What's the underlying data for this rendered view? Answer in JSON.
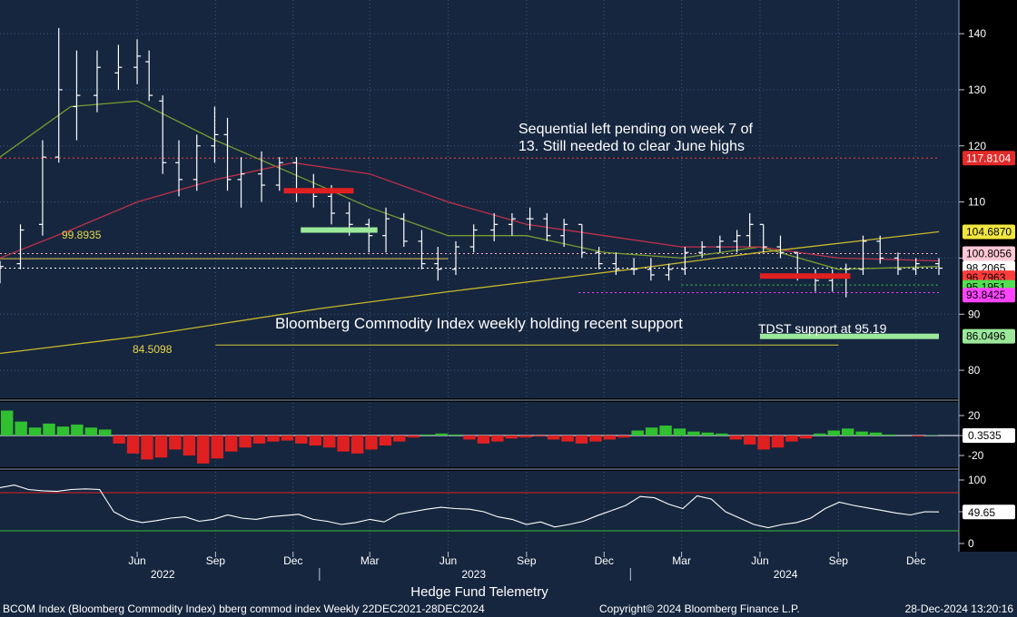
{
  "chart_data": {
    "type": "candlestick",
    "main_panel": {
      "ylim": [
        75,
        146
      ],
      "y_ticks": [
        80,
        90,
        100,
        110,
        120,
        130,
        140
      ],
      "price_bars": [
        {
          "date": "2021-12-22",
          "o": 96.5,
          "h": 99.5,
          "l": 95.5,
          "c": 98.5
        },
        {
          "date": "2022-01-15",
          "o": 99,
          "h": 106,
          "l": 98,
          "c": 105
        },
        {
          "date": "2022-02-10",
          "o": 106,
          "h": 121,
          "l": 104,
          "c": 118
        },
        {
          "date": "2022-03-01",
          "o": 118,
          "h": 141,
          "l": 117,
          "c": 130
        },
        {
          "date": "2022-03-22",
          "o": 127,
          "h": 137,
          "l": 121,
          "c": 129
        },
        {
          "date": "2022-04-15",
          "o": 129,
          "h": 137,
          "l": 126,
          "c": 134
        },
        {
          "date": "2022-05-10",
          "o": 133,
          "h": 138,
          "l": 130,
          "c": 134
        },
        {
          "date": "2022-06-01",
          "o": 134,
          "h": 139,
          "l": 131,
          "c": 136
        },
        {
          "date": "2022-06-15",
          "o": 135,
          "h": 137,
          "l": 128,
          "c": 129
        },
        {
          "date": "2022-07-01",
          "o": 128,
          "h": 129,
          "l": 115,
          "c": 117
        },
        {
          "date": "2022-07-20",
          "o": 117,
          "h": 121,
          "l": 111,
          "c": 114
        },
        {
          "date": "2022-08-10",
          "o": 114,
          "h": 122,
          "l": 112,
          "c": 120
        },
        {
          "date": "2022-08-31",
          "o": 120,
          "h": 127,
          "l": 117,
          "c": 122
        },
        {
          "date": "2022-09-15",
          "o": 122,
          "h": 125,
          "l": 112,
          "c": 114
        },
        {
          "date": "2022-10-01",
          "o": 114,
          "h": 118,
          "l": 109,
          "c": 115
        },
        {
          "date": "2022-10-25",
          "o": 115,
          "h": 119,
          "l": 110,
          "c": 113
        },
        {
          "date": "2022-11-15",
          "o": 113,
          "h": 118,
          "l": 112,
          "c": 117
        },
        {
          "date": "2022-12-05",
          "o": 117,
          "h": 118,
          "l": 110,
          "c": 112
        },
        {
          "date": "2022-12-25",
          "o": 112,
          "h": 115,
          "l": 109,
          "c": 111
        },
        {
          "date": "2023-01-15",
          "o": 111,
          "h": 113,
          "l": 106,
          "c": 108
        },
        {
          "date": "2023-02-05",
          "o": 108,
          "h": 110,
          "l": 104,
          "c": 106
        },
        {
          "date": "2023-02-28",
          "o": 106,
          "h": 107,
          "l": 101,
          "c": 104
        },
        {
          "date": "2023-03-20",
          "o": 104,
          "h": 109,
          "l": 101,
          "c": 107
        },
        {
          "date": "2023-04-10",
          "o": 107,
          "h": 108,
          "l": 102,
          "c": 103
        },
        {
          "date": "2023-05-01",
          "o": 103,
          "h": 105,
          "l": 98,
          "c": 99
        },
        {
          "date": "2023-05-20",
          "o": 99,
          "h": 102,
          "l": 96,
          "c": 98
        },
        {
          "date": "2023-06-10",
          "o": 98,
          "h": 103,
          "l": 97,
          "c": 102
        },
        {
          "date": "2023-07-01",
          "o": 102,
          "h": 106,
          "l": 101,
          "c": 105
        },
        {
          "date": "2023-07-25",
          "o": 105,
          "h": 108,
          "l": 103,
          "c": 106
        },
        {
          "date": "2023-08-15",
          "o": 106,
          "h": 108,
          "l": 104,
          "c": 107
        },
        {
          "date": "2023-09-05",
          "o": 107,
          "h": 109,
          "l": 105,
          "c": 107
        },
        {
          "date": "2023-09-25",
          "o": 107,
          "h": 108,
          "l": 103,
          "c": 104
        },
        {
          "date": "2023-10-15",
          "o": 104,
          "h": 107,
          "l": 102,
          "c": 106
        },
        {
          "date": "2023-11-05",
          "o": 106,
          "h": 106,
          "l": 100,
          "c": 101
        },
        {
          "date": "2023-11-25",
          "o": 101,
          "h": 102,
          "l": 98,
          "c": 99
        },
        {
          "date": "2023-12-15",
          "o": 99,
          "h": 101,
          "l": 97,
          "c": 98
        },
        {
          "date": "2024-01-05",
          "o": 98,
          "h": 100,
          "l": 97,
          "c": 98
        },
        {
          "date": "2024-01-25",
          "o": 98,
          "h": 100,
          "l": 96,
          "c": 97
        },
        {
          "date": "2024-02-15",
          "o": 97,
          "h": 99,
          "l": 96,
          "c": 98
        },
        {
          "date": "2024-03-05",
          "o": 98,
          "h": 102,
          "l": 97,
          "c": 101
        },
        {
          "date": "2024-03-25",
          "o": 101,
          "h": 103,
          "l": 100,
          "c": 102
        },
        {
          "date": "2024-04-15",
          "o": 102,
          "h": 104,
          "l": 101,
          "c": 103
        },
        {
          "date": "2024-05-05",
          "o": 103,
          "h": 105,
          "l": 101,
          "c": 104
        },
        {
          "date": "2024-05-20",
          "o": 104,
          "h": 108,
          "l": 102,
          "c": 106
        },
        {
          "date": "2024-06-05",
          "o": 106,
          "h": 106,
          "l": 101,
          "c": 102
        },
        {
          "date": "2024-06-25",
          "o": 102,
          "h": 104,
          "l": 100,
          "c": 101
        },
        {
          "date": "2024-07-15",
          "o": 101,
          "h": 101,
          "l": 96,
          "c": 97
        },
        {
          "date": "2024-08-05",
          "o": 97,
          "h": 98,
          "l": 94,
          "c": 96
        },
        {
          "date": "2024-08-25",
          "o": 96,
          "h": 98,
          "l": 94,
          "c": 97
        },
        {
          "date": "2024-09-10",
          "o": 97,
          "h": 99,
          "l": 93,
          "c": 98
        },
        {
          "date": "2024-09-30",
          "o": 98,
          "h": 104,
          "l": 97,
          "c": 103
        },
        {
          "date": "2024-10-20",
          "o": 103,
          "h": 104,
          "l": 99,
          "c": 100
        },
        {
          "date": "2024-11-10",
          "o": 100,
          "h": 101,
          "l": 97,
          "c": 98
        },
        {
          "date": "2024-12-01",
          "o": 98,
          "h": 100,
          "l": 97,
          "c": 99
        },
        {
          "date": "2024-12-28",
          "o": 99,
          "h": 100,
          "l": 97,
          "c": 98.2
        }
      ],
      "moving_averages": [
        {
          "color": "#7a9c2e",
          "points": [
            [
              "2021-12-22",
              118
            ],
            [
              "2022-03-15",
              127
            ],
            [
              "2022-06-01",
              128
            ],
            [
              "2022-09-01",
              121
            ],
            [
              "2022-12-01",
              115
            ],
            [
              "2023-03-01",
              109
            ],
            [
              "2023-06-01",
              104
            ],
            [
              "2023-09-01",
              104
            ],
            [
              "2023-12-01",
              101
            ],
            [
              "2024-03-01",
              100
            ],
            [
              "2024-06-01",
              102
            ],
            [
              "2024-09-01",
              98
            ],
            [
              "2024-12-28",
              98.5
            ]
          ]
        },
        {
          "color": "#c0304a",
          "points": [
            [
              "2021-12-22",
              100
            ],
            [
              "2022-03-15",
              105
            ],
            [
              "2022-06-01",
              110
            ],
            [
              "2022-09-01",
              114
            ],
            [
              "2022-12-01",
              117
            ],
            [
              "2023-03-01",
              115
            ],
            [
              "2023-06-01",
              110
            ],
            [
              "2023-09-01",
              106
            ],
            [
              "2023-12-01",
              104
            ],
            [
              "2024-03-01",
              102
            ],
            [
              "2024-06-01",
              102
            ],
            [
              "2024-09-01",
              100
            ],
            [
              "2024-12-28",
              99.5
            ]
          ]
        },
        {
          "color": "#c7b82a",
          "points": [
            [
              "2021-12-22",
              83
            ],
            [
              "2022-06-01",
              86
            ],
            [
              "2023-01-01",
              91
            ],
            [
              "2023-06-01",
              94
            ],
            [
              "2024-01-01",
              98
            ],
            [
              "2024-06-01",
              101
            ],
            [
              "2024-12-28",
              104.687
            ]
          ]
        }
      ],
      "hlines": [
        {
          "value": 117.8104,
          "color": "#ff4040",
          "style": "dotted"
        },
        {
          "value": 99.8935,
          "color": "#e0c040",
          "style": "solid",
          "start": "2021-12-22",
          "end": "2023-06-01"
        },
        {
          "value": 84.5098,
          "color": "#d4c43a",
          "style": "solid",
          "start": "2022-09-01",
          "end": "2024-09-01"
        },
        {
          "value": 95.1951,
          "color": "#40d040",
          "style": "dotted",
          "start": "2024-03-01",
          "end": "2024-12-28"
        },
        {
          "value": 100.8056,
          "color": "#ffb0c0",
          "style": "dotted"
        },
        {
          "value": 93.8425,
          "color": "#ff40ff",
          "style": "dotted",
          "start": "2023-11-01",
          "end": "2024-12-28"
        },
        {
          "value": 98.2065,
          "color": "#ffffff",
          "style": "dotted"
        }
      ],
      "levels_labels": [
        "99.8935",
        "84.5098"
      ],
      "annotations": [
        "Sequential left pending on week 7 of",
        "13.  Still needed to clear June highs",
        "Bloomberg Commodity Index weekly holding recent support",
        "TDST support at 95.19"
      ],
      "price_tags": [
        {
          "value": "117.8104",
          "bg": "#e22a2a",
          "fg": "#ffffff",
          "y": 117.81
        },
        {
          "value": "104.6870",
          "bg": "#f0e640",
          "fg": "#000000",
          "y": 104.687
        },
        {
          "value": "100.8056",
          "bg": "#ffc8d6",
          "fg": "#000000",
          "y": 100.8
        },
        {
          "value": "98.2065",
          "bg": "#ffffff",
          "fg": "#000000",
          "y": 98.2
        },
        {
          "value": "96.7963",
          "bg": "#ff3c3c",
          "fg": "#000000",
          "y": 96.5
        },
        {
          "value": "95.1951",
          "bg": "#50e050",
          "fg": "#000000",
          "y": 94.8
        },
        {
          "value": "93.8425",
          "bg": "#ff44ff",
          "fg": "#000000",
          "y": 93.4
        },
        {
          "value": "86.0496",
          "bg": "#9be89b",
          "fg": "#000000",
          "y": 86.05
        }
      ]
    },
    "histogram_panel": {
      "ylim": [
        -30,
        30
      ],
      "y_ticks": [
        20,
        0,
        -20
      ],
      "last_value": "0.3535",
      "values": [
        25,
        14,
        8,
        12,
        9,
        11,
        8,
        6,
        -8,
        -18,
        -24,
        -22,
        -14,
        -20,
        -28,
        -23,
        -16,
        -12,
        -8,
        -6,
        -5,
        -8,
        -10,
        -12,
        -16,
        -18,
        -14,
        -10,
        -6,
        -2,
        1,
        2,
        1,
        -4,
        -8,
        -6,
        -3,
        -2,
        -1,
        -4,
        -6,
        -8,
        -6,
        -4,
        -2,
        5,
        8,
        10,
        7,
        4,
        3,
        2,
        -4,
        -9,
        -14,
        -12,
        -6,
        -3,
        2,
        5,
        7,
        4,
        3,
        1,
        0,
        -1,
        0.3535
      ]
    },
    "oscillator_panel": {
      "ylim": [
        -10,
        110
      ],
      "y_ticks": [
        100,
        50,
        0
      ],
      "upper_line": 80,
      "lower_line": 20,
      "last_value": "49.65",
      "values": [
        88,
        92,
        85,
        83,
        82,
        85,
        86,
        85,
        50,
        38,
        33,
        36,
        40,
        42,
        35,
        38,
        45,
        40,
        38,
        42,
        44,
        46,
        38,
        35,
        30,
        33,
        38,
        34,
        46,
        50,
        54,
        57,
        55,
        54,
        50,
        42,
        38,
        30,
        34,
        26,
        30,
        35,
        44,
        52,
        60,
        74,
        72,
        62,
        55,
        75,
        70,
        50,
        40,
        30,
        25,
        30,
        33,
        40,
        55,
        65,
        60,
        56,
        52,
        48,
        45,
        50,
        49.65
      ]
    },
    "x_axis": {
      "month_ticks": [
        {
          "label": "Jun",
          "date": "2022-06-01"
        },
        {
          "label": "Sep",
          "date": "2022-09-01"
        },
        {
          "label": "Dec",
          "date": "2022-12-01"
        },
        {
          "label": "Mar",
          "date": "2023-03-01"
        },
        {
          "label": "Jun",
          "date": "2023-06-01"
        },
        {
          "label": "Sep",
          "date": "2023-09-01"
        },
        {
          "label": "Dec",
          "date": "2023-12-01"
        },
        {
          "label": "Mar",
          "date": "2024-03-01"
        },
        {
          "label": "Jun",
          "date": "2024-06-01"
        },
        {
          "label": "Sep",
          "date": "2024-09-01"
        },
        {
          "label": "Dec",
          "date": "2024-12-01"
        }
      ],
      "year_labels": [
        {
          "label": "2022",
          "date": "2022-07-01"
        },
        {
          "label": "2023",
          "date": "2023-07-01"
        },
        {
          "label": "2024",
          "date": "2024-07-01"
        }
      ],
      "range": [
        "2021-12-22",
        "2024-12-28"
      ]
    }
  },
  "footer": {
    "credit": "Hedge Fund Telemetry",
    "security": "BCOM Index (Bloomberg Commodity Index) bberg commod index  Weekly 22DEC2021-28DEC2024",
    "copyright": "Copyright© 2024 Bloomberg Finance L.P.",
    "timestamp": "28-Dec-2024 13:20:16"
  }
}
